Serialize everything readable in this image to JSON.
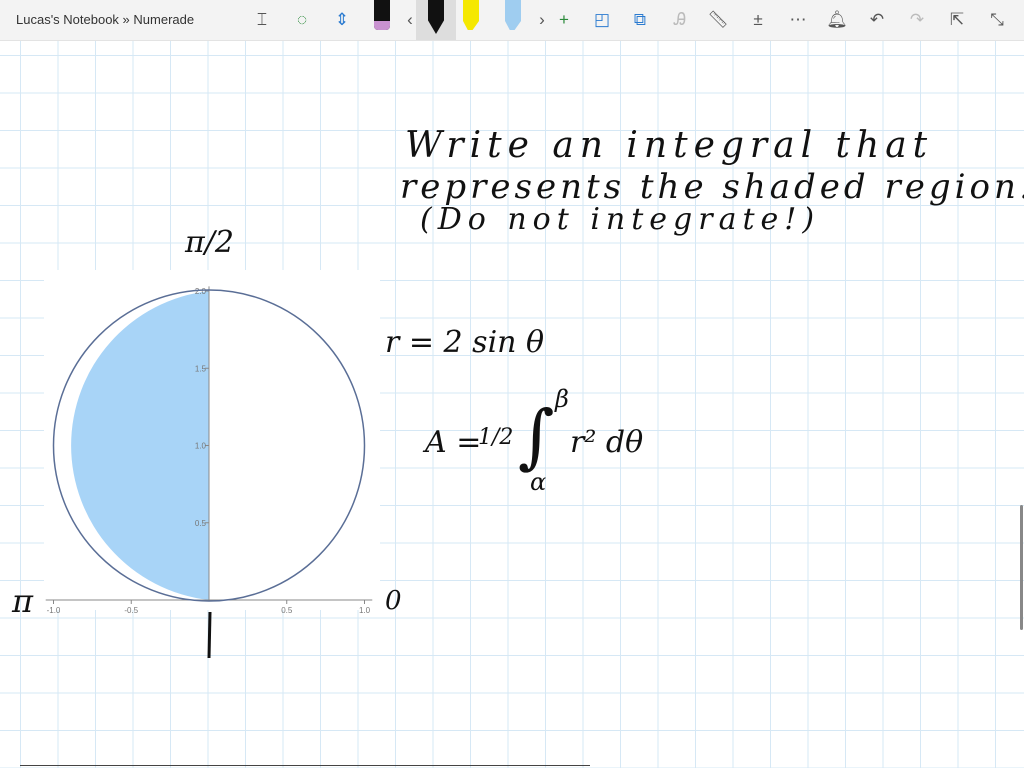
{
  "window": {
    "title": "Lucas's Notebook » Numerade"
  },
  "toolbar": {
    "icons": [
      "text-select-icon",
      "lasso-add-icon",
      "insert-space-icon",
      "pen-pink-icon",
      "chevron-left-icon",
      "pen-black-icon",
      "highlighter-yellow-icon",
      "highlighter-blue-icon",
      "chevron-right-icon",
      "add-icon",
      "shapes-icon",
      "convert-icon",
      "ink-to-text-icon",
      "ruler-icon",
      "math-icon",
      "more-icon",
      "notifications-icon",
      "undo-icon",
      "redo-icon",
      "share-icon",
      "collapse-icon"
    ],
    "colors": {
      "pink": "#c992d0",
      "yellow": "#f5e800",
      "blue": "#9fcdf0",
      "black": "#111111"
    }
  },
  "notes": {
    "line1": "Write an integral that",
    "line2": "represents the shaded region:",
    "line3": "(Do not integrate!)",
    "label_top": "π/2",
    "label_left": "π",
    "label_right": "0",
    "curve_label": "r = 2 sin θ",
    "formula_A": "A =",
    "formula_half": "1/2",
    "formula_int": "∫",
    "formula_upper": "β",
    "formula_lower": "α",
    "formula_body": "r² dθ"
  },
  "chart_data": {
    "type": "line",
    "title": "",
    "curve": "r = 2 sin θ (circle x² + (y-1)² = 1)",
    "xlim": [
      -1,
      1
    ],
    "ylim": [
      0,
      2
    ],
    "xticks": [
      "-1.0",
      "-0.5",
      "0.5",
      "1.0"
    ],
    "yticks": [
      "0.5",
      "1.0",
      "1.5",
      "2.0"
    ],
    "shaded": "left half of circle (x ≤ 0)",
    "colors": {
      "curve": "#5a6e96",
      "shade": "#a8d4f7"
    }
  }
}
